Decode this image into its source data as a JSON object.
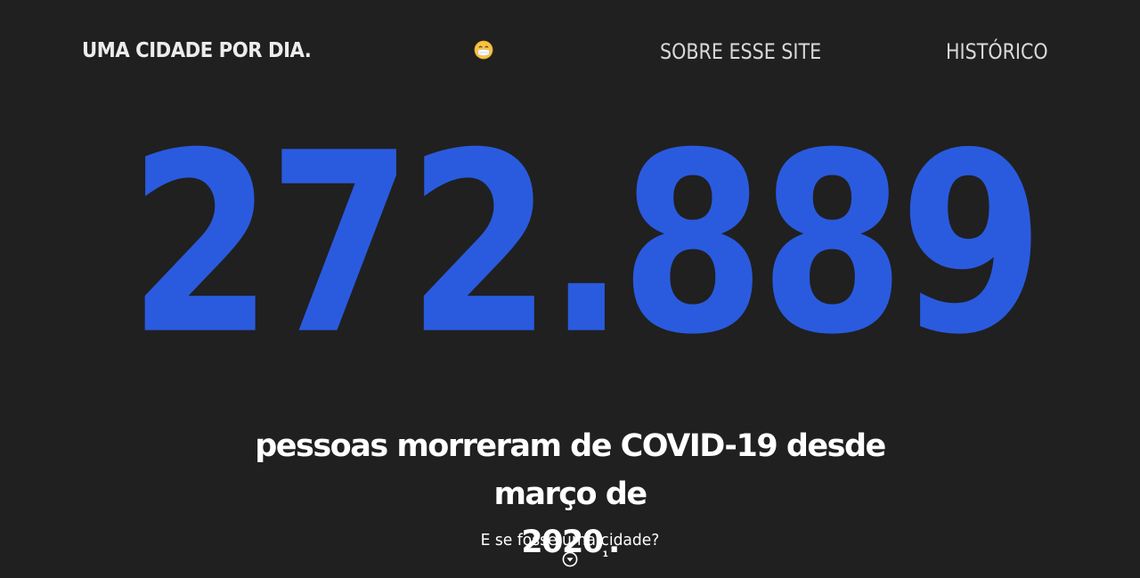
{
  "nav": {
    "brand": "UMA CIDADE POR DIA.",
    "mask_icon": "face-with-medical-mask-icon",
    "about_label": "SOBRE ESSE SITE",
    "history_label": "HISTÓRICO"
  },
  "hero": {
    "count": "272.889",
    "caption_line1": "pessoas morreram de COVID-19 desde março de",
    "caption_line2_year": "2020",
    "caption_footnote": "1",
    "caption_period": "."
  },
  "cta": {
    "label": "E se fosse uma cidade?",
    "icon": "chevron-down-circle-icon"
  },
  "colors": {
    "background": "#202020",
    "accent": "#2a5bdf",
    "text": "#ffffff"
  }
}
